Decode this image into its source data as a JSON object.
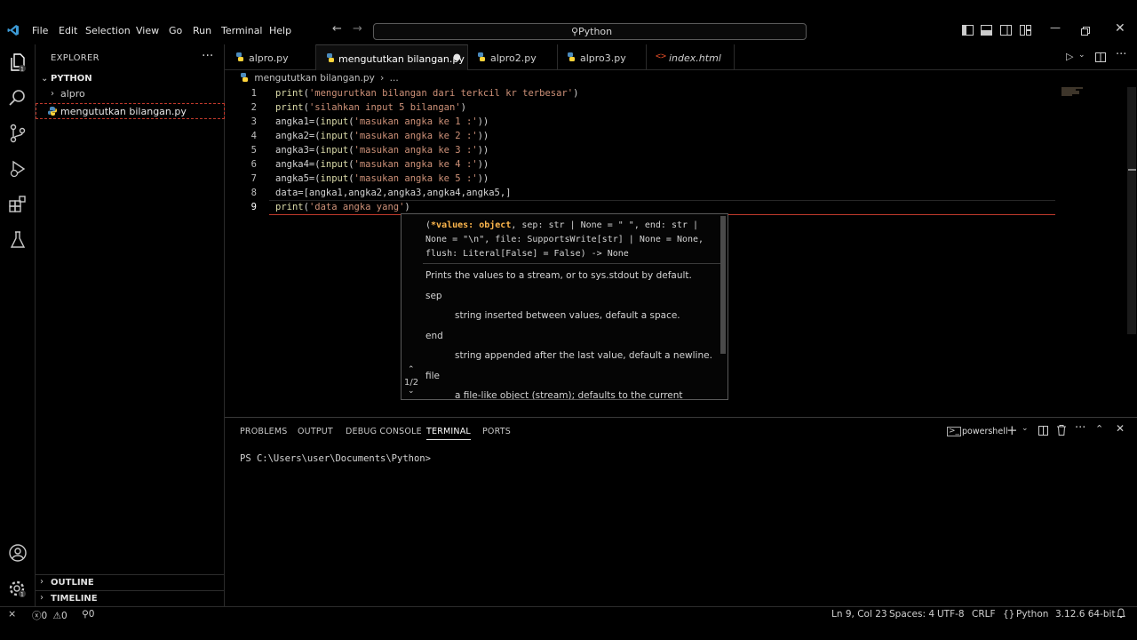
{
  "titlebar": {
    "menus": [
      "File",
      "Edit",
      "Selection",
      "View",
      "Go",
      "Run",
      "Terminal",
      "Help"
    ],
    "search_text": "Python"
  },
  "sidebar": {
    "header": "EXPLORER",
    "root": "PYTHON",
    "items": [
      {
        "label": "alpro",
        "type": "folder"
      },
      {
        "label": "mengututkan bilangan.py",
        "type": "file"
      }
    ],
    "outline": "OUTLINE",
    "timeline": "TIMELINE"
  },
  "tabs": [
    {
      "label": "alpro.py"
    },
    {
      "label": "mengututkan bilangan.py",
      "active": true,
      "modified": true
    },
    {
      "label": "alpro2.py"
    },
    {
      "label": "alpro3.py"
    },
    {
      "label": "index.html"
    }
  ],
  "breadcrumb": {
    "file": "mengututkan bilangan.py",
    "more": "..."
  },
  "editor": {
    "lines": [
      {
        "n": "1",
        "func": "print",
        "open": "(",
        "str": "'mengurutkan bilangan dari terkcil kr terbesar'",
        "close": ")"
      },
      {
        "n": "2",
        "func": "print",
        "open": "(",
        "str": "'silahkan input 5 bilangan'",
        "close": ")"
      },
      {
        "n": "3",
        "pre": "angka1=(",
        "func": "input",
        "open": "(",
        "str": "'masukan angka ke 1 :'",
        "close": "))"
      },
      {
        "n": "4",
        "pre": "angka2=(",
        "func": "input",
        "open": "(",
        "str": "'masukan angka ke 2 :'",
        "close": "))"
      },
      {
        "n": "5",
        "pre": "angka3=(",
        "func": "input",
        "open": "(",
        "str": "'masukan angka ke 3 :'",
        "close": "))"
      },
      {
        "n": "6",
        "pre": "angka4=(",
        "func": "input",
        "open": "(",
        "str": "'masukan angka ke 4 :'",
        "close": "))"
      },
      {
        "n": "7",
        "pre": "angka5=(",
        "func": "input",
        "open": "(",
        "str": "'masukan angka ke 5 :'",
        "close": "))"
      },
      {
        "n": "8",
        "pre": "data=[angka1,angka2,angka3,angka4,angka5,]"
      },
      {
        "n": "9",
        "func": "print",
        "open": "(",
        "str": "'data angka yang'",
        "close": ")"
      }
    ]
  },
  "hover": {
    "sig_line1_a": "(",
    "sig_line1_b": "*values: object",
    "sig_line1_c": ", sep: str | None = \" \", end: str |",
    "sig_line2": "None = \"\\n\", file: SupportsWrite[str] | None = None,",
    "sig_line3": "flush: Literal[False] = False) -> None",
    "description": "Prints the values to a stream, or to sys.stdout by default.",
    "sep_label": "sep",
    "sep_desc": "string inserted between values, default a space.",
    "end_label": "end",
    "end_desc": "string appended after the last value, default a newline.",
    "file_label": "file",
    "file_desc": "a file-like object (stream); defaults to the current",
    "pager": "1/2"
  },
  "panel": {
    "tabs": [
      "PROBLEMS",
      "OUTPUT",
      "DEBUG CONSOLE",
      "TERMINAL",
      "PORTS"
    ],
    "active_tab": "TERMINAL",
    "shell": "powershell",
    "prompt": "PS C:\\Users\\user\\Documents\\Python>"
  },
  "statusbar": {
    "errors": "0",
    "warnings": "0",
    "ports": "0",
    "position": "Ln 9, Col 23",
    "spaces": "Spaces: 4",
    "encoding": "UTF-8",
    "eol": "CRLF",
    "language": "Python",
    "interpreter": "3.12.6 64-bit"
  },
  "colors": {
    "accent_red": "#c0392b",
    "string": "#ce9178",
    "function": "#dcdcaa",
    "python_blue": "#4b8bbe",
    "python_yellow": "#ffd43b",
    "html_orange": "#e44d26",
    "vscode_blue": "#3c99d4"
  }
}
